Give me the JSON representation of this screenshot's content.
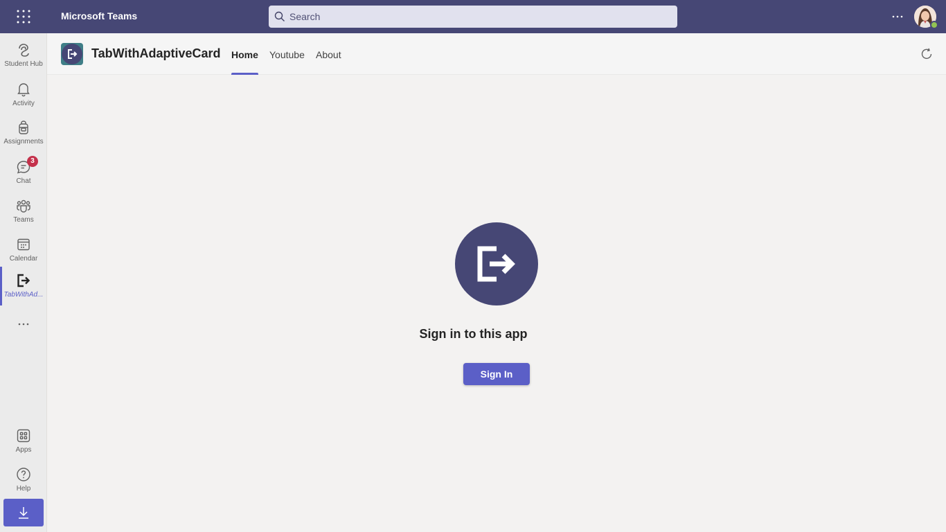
{
  "topbar": {
    "app_name": "Microsoft Teams",
    "search_placeholder": "Search",
    "bg_color": "#464775"
  },
  "rail": {
    "items": [
      {
        "label": "Student Hub",
        "icon": "student-hub-icon"
      },
      {
        "label": "Activity",
        "icon": "bell-icon"
      },
      {
        "label": "Assignments",
        "icon": "backpack-icon"
      },
      {
        "label": "Chat",
        "icon": "chat-icon",
        "badge": "3"
      },
      {
        "label": "Teams",
        "icon": "teams-icon"
      },
      {
        "label": "Calendar",
        "icon": "calendar-icon"
      },
      {
        "label": "TabWithAd...",
        "icon": "app-signout-icon",
        "active": true
      }
    ],
    "more": "more-apps-icon",
    "bottom_items": [
      {
        "label": "Apps",
        "icon": "apps-grid-icon"
      },
      {
        "label": "Help",
        "icon": "help-icon"
      }
    ],
    "download": "download-icon"
  },
  "app_header": {
    "title": "TabWithAdaptiveCard",
    "tabs": [
      {
        "label": "Home",
        "active": true
      },
      {
        "label": "Youtube",
        "active": false
      },
      {
        "label": "About",
        "active": false
      }
    ],
    "refresh": "refresh-icon"
  },
  "main": {
    "heading": "Sign in to this app",
    "button_label": "Sign In",
    "accent_color": "#5b5fc7"
  }
}
